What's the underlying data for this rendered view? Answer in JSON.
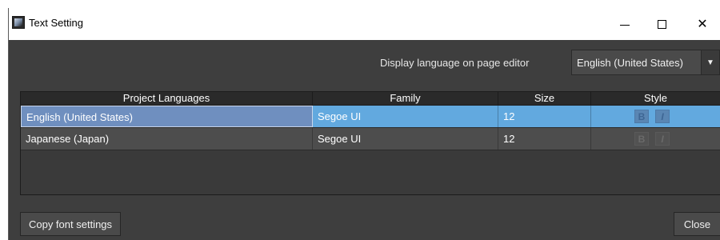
{
  "window": {
    "title": "Text Setting",
    "controls": {
      "minimize": "minimize",
      "maximize": "maximize",
      "close": "✕"
    }
  },
  "display_language": {
    "label": "Display language on page editor",
    "selected": "English (United States)"
  },
  "table": {
    "columns": [
      "Project Languages",
      "Family",
      "Size",
      "Style"
    ],
    "rows": [
      {
        "language": "English (United States)",
        "family": "Segoe UI",
        "size": "12",
        "bold": "B",
        "italic": "I",
        "selected": true
      },
      {
        "language": "Japanese (Japan)",
        "family": "Segoe UI",
        "size": "12",
        "bold": "B",
        "italic": "I",
        "selected": false
      }
    ]
  },
  "buttons": {
    "copy_font_settings": "Copy font settings",
    "close": "Close"
  },
  "colors": {
    "window_bg": "#3e3e3e",
    "selected_row": "#62a9df",
    "header_bg": "#2a2a2a"
  }
}
